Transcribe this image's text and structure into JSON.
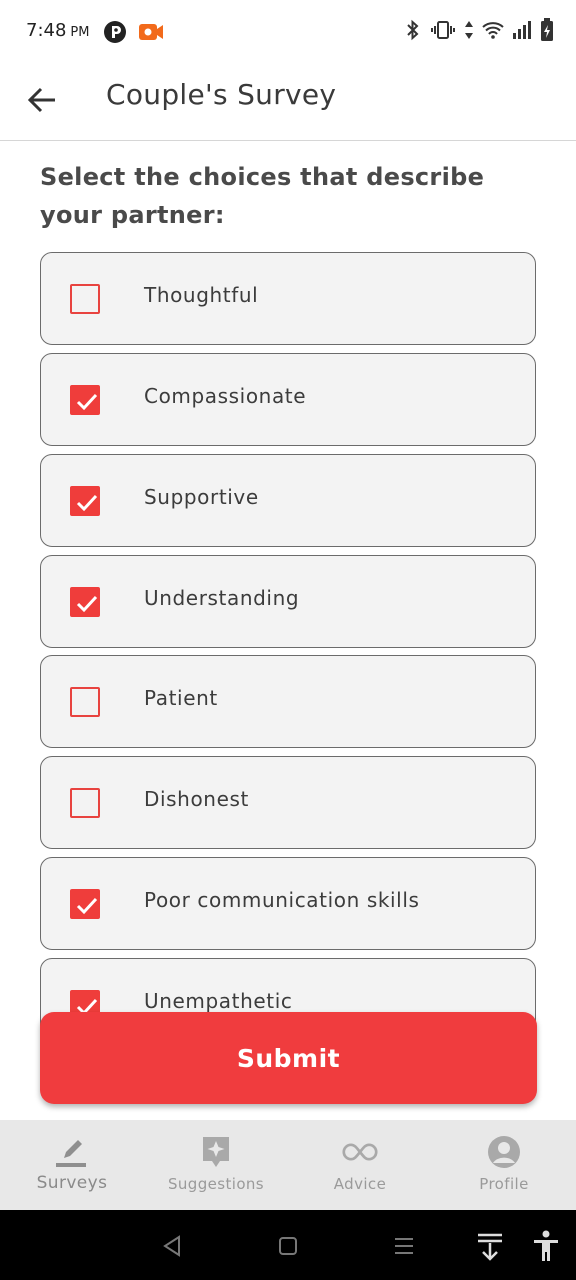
{
  "status_bar": {
    "time": "7:48",
    "ampm": "PM"
  },
  "app_bar": {
    "title": "Couple's Survey"
  },
  "question": "Select the choices that describe your partner:",
  "options": [
    {
      "label": "Thoughtful",
      "checked": false
    },
    {
      "label": "Compassionate",
      "checked": true
    },
    {
      "label": "Supportive",
      "checked": true
    },
    {
      "label": "Understanding",
      "checked": true
    },
    {
      "label": "Patient",
      "checked": false
    },
    {
      "label": "Dishonest",
      "checked": false
    },
    {
      "label": "Poor communication skills",
      "checked": true
    },
    {
      "label": "Unempathetic",
      "checked": true
    }
  ],
  "submit_label": "Submit",
  "bottom_nav": [
    {
      "label": "Surveys",
      "icon": "pencil-icon",
      "active": true
    },
    {
      "label": "Suggestions",
      "icon": "sparkle-icon",
      "active": false
    },
    {
      "label": "Advice",
      "icon": "infinity-icon",
      "active": false
    },
    {
      "label": "Profile",
      "icon": "person-icon",
      "active": false
    }
  ],
  "colors": {
    "accent": "#F03C3E",
    "option_bg": "#F3F3F3",
    "nav_bg": "#E8E8E8"
  }
}
